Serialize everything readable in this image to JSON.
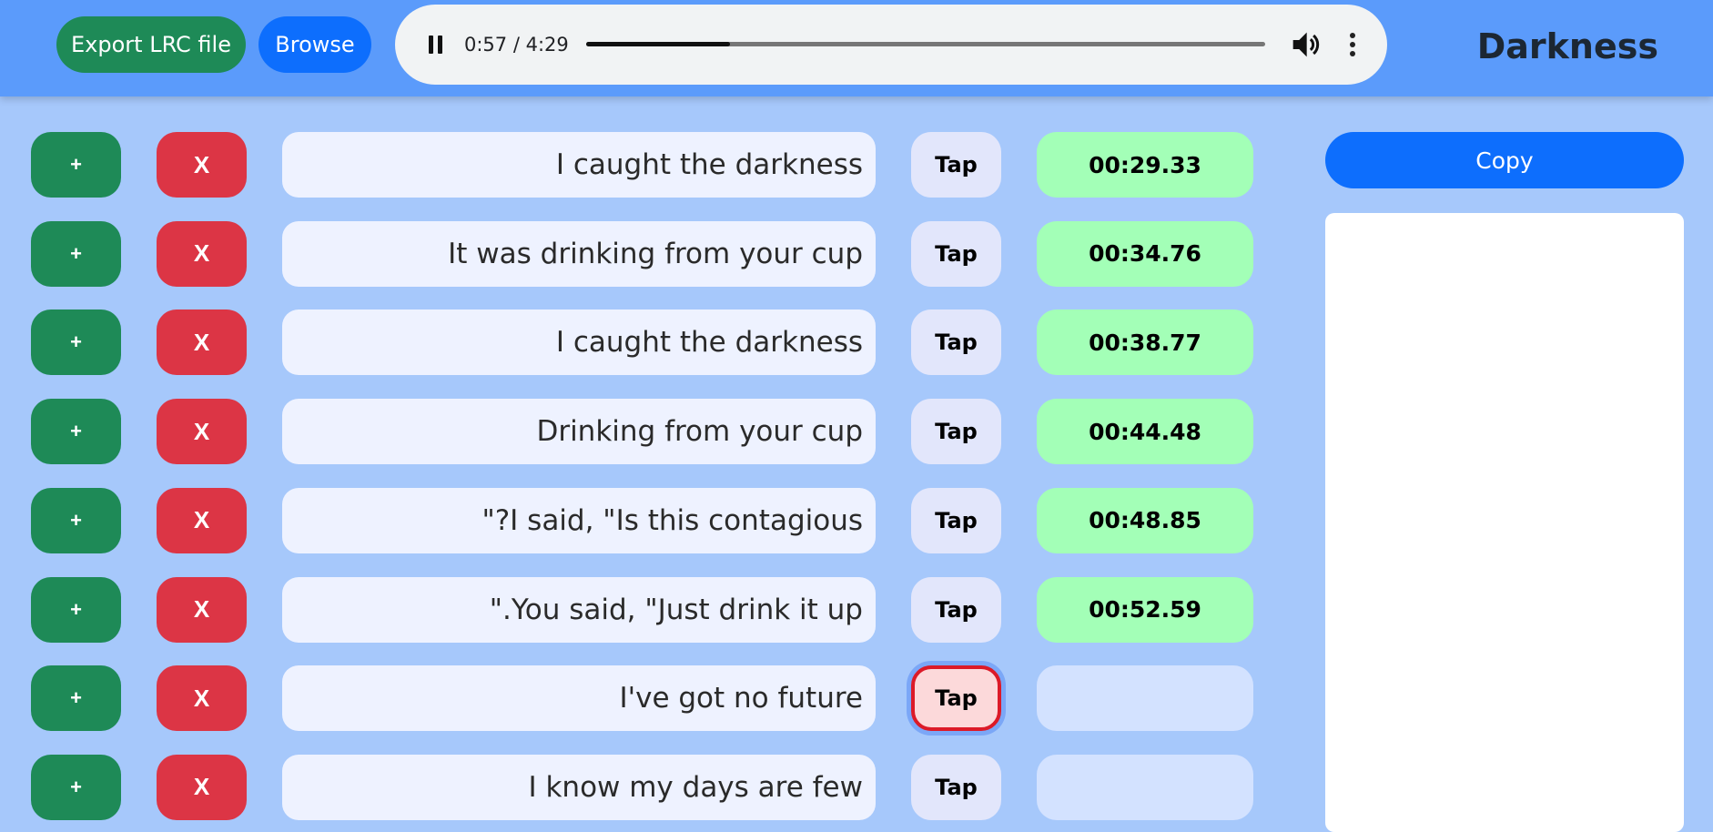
{
  "header": {
    "export_label": "Export LRC file",
    "browse_label": "Browse",
    "title": "Darkness"
  },
  "player": {
    "time_display": "0:57 / 4:29",
    "progress": 0.2119,
    "play_icon": "pause-icon",
    "volume_icon": "volume-icon",
    "menu_icon": "more-vert-icon"
  },
  "rows": [
    {
      "add": "+",
      "delete": "X",
      "lyric": "I caught the darkness",
      "tap": "Tap",
      "timestamp": "00:29.33"
    },
    {
      "add": "+",
      "delete": "X",
      "lyric": "It was drinking from your cup",
      "tap": "Tap",
      "timestamp": "00:34.76"
    },
    {
      "add": "+",
      "delete": "X",
      "lyric": "I caught the darkness",
      "tap": "Tap",
      "timestamp": "00:38.77"
    },
    {
      "add": "+",
      "delete": "X",
      "lyric": "Drinking from your cup",
      "tap": "Tap",
      "timestamp": "00:44.48"
    },
    {
      "add": "+",
      "delete": "X",
      "lyric": "\"?I said, \"Is this contagious",
      "tap": "Tap",
      "timestamp": "00:48.85"
    },
    {
      "add": "+",
      "delete": "X",
      "lyric": "\".You said, \"Just drink it up",
      "tap": "Tap",
      "timestamp": "00:52.59"
    },
    {
      "add": "+",
      "delete": "X",
      "lyric": "I've got no future",
      "tap": "Tap",
      "timestamp": "",
      "active": true
    },
    {
      "add": "+",
      "delete": "X",
      "lyric": "I know my days are few",
      "tap": "Tap",
      "timestamp": ""
    }
  ],
  "sidebar": {
    "copy_label": "Copy",
    "output_text": ""
  },
  "colors": {
    "background": "#a6c8fb",
    "header": "#5b9bfb",
    "add_button": "#1e8a57",
    "delete_button": "#dc3545",
    "timestamp_filled": "#a3ffb7",
    "primary": "#0d6efd"
  }
}
